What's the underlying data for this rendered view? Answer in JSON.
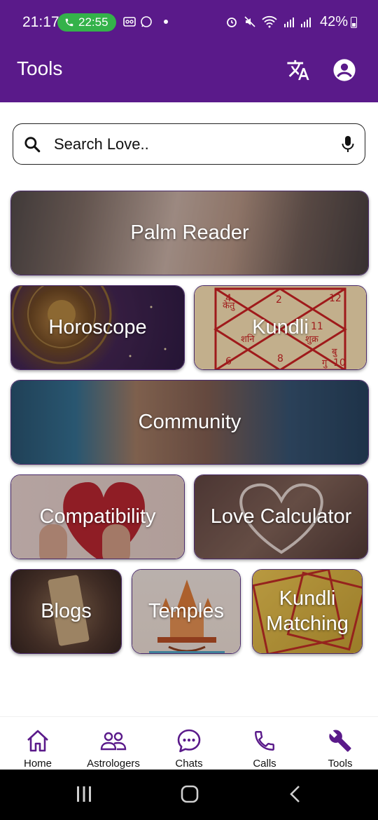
{
  "status_bar": {
    "time": "21:17",
    "call_timer": "22:55",
    "battery": "42%",
    "icons": [
      "voicemail-icon",
      "whatsapp-icon",
      "alarm-icon",
      "mute-icon",
      "wifi-icon",
      "signal-icon"
    ]
  },
  "app_bar": {
    "title": "Tools",
    "translate_icon": "translate-icon",
    "profile_icon": "account-circle-icon",
    "color": "#5a1a8a"
  },
  "search": {
    "placeholder": "Search Love..",
    "value": ""
  },
  "tools": {
    "palm_reader": "Palm Reader",
    "horoscope": "Horoscope",
    "kundli": "Kundli",
    "community": "Community",
    "compatibility": "Compatibility",
    "love_calculator": "Love Calculator",
    "blogs": "Blogs",
    "temples": "Temples",
    "kundli_matching": "Kundli Matching"
  },
  "kundli_chart_marks": [
    "4",
    "2",
    "12",
    "केतु",
    "शनि",
    "11",
    "शुक्र",
    "6",
    "8",
    "बु",
    "गु",
    "10"
  ],
  "bottom_nav": {
    "items": [
      {
        "label": "Home",
        "icon": "home-icon"
      },
      {
        "label": "Astrologers",
        "icon": "people-icon"
      },
      {
        "label": "Chats",
        "icon": "chat-icon"
      },
      {
        "label": "Calls",
        "icon": "phone-icon"
      },
      {
        "label": "Tools",
        "icon": "wrench-icon"
      }
    ],
    "active": "Tools",
    "accent": "#5a1a8a"
  }
}
